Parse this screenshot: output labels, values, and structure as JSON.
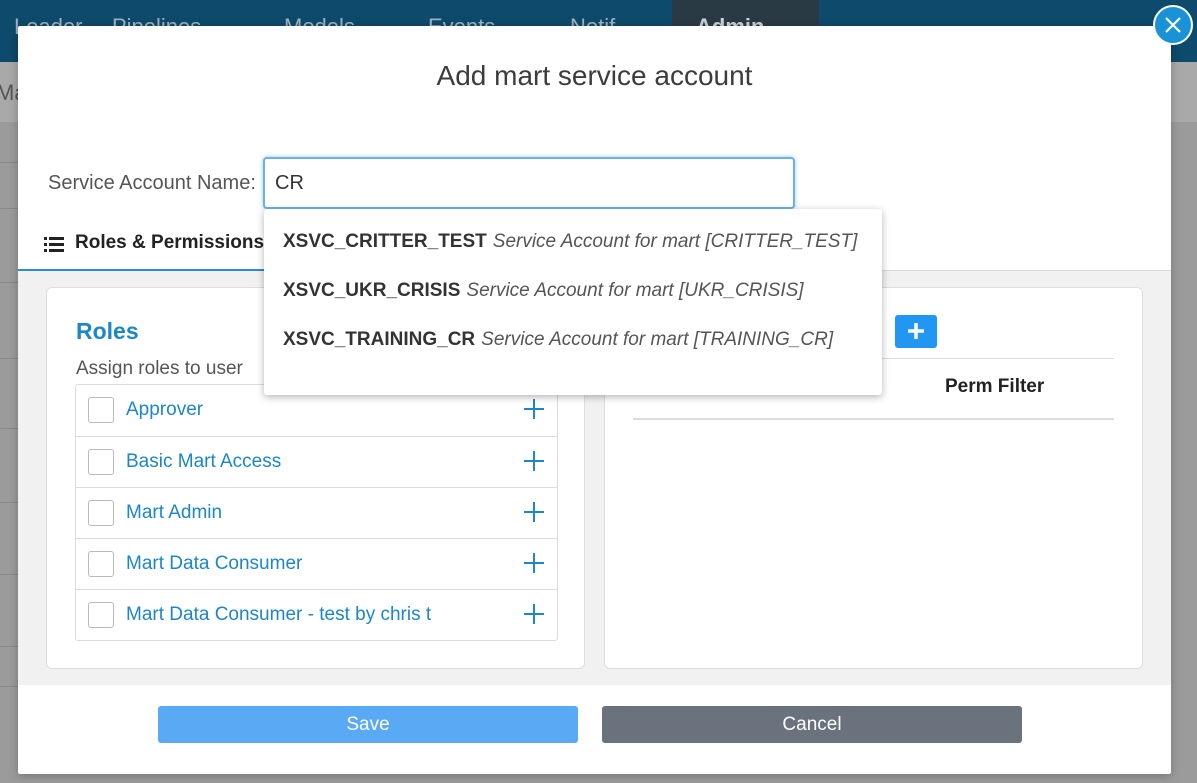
{
  "background": {
    "nav_items": [
      "Loader",
      "Pipelines",
      "Models",
      "Events",
      "Notif"
    ],
    "nav_active": "Admin",
    "subbar_text": "Ma"
  },
  "modal": {
    "title": "Add mart service account",
    "field_label": "Service Account Name:",
    "field_value": "CR",
    "tab_label": "Roles & Permissions",
    "roles_title": "Roles",
    "roles_subtitle": "Assign roles to user",
    "roles": [
      {
        "label": "Approver",
        "checked": false
      },
      {
        "label": "Basic Mart Access",
        "checked": false
      },
      {
        "label": "Mart Admin",
        "checked": false
      },
      {
        "label": "Mart Data Consumer",
        "checked": false
      },
      {
        "label": "Mart Data Consumer - test by chris t",
        "checked": false
      }
    ],
    "perm_filter_header": "Perm Filter",
    "save_label": "Save",
    "cancel_label": "Cancel"
  },
  "suggestions": [
    {
      "code": "XSVC_CRITTER_TEST",
      "description": "Service Account for mart [CRITTER_TEST]"
    },
    {
      "code": "XSVC_UKR_CRISIS",
      "description": "Service Account for mart [UKR_CRISIS]"
    },
    {
      "code": "XSVC_TRAINING_CR",
      "description": "Service Account for mart [TRAINING_CR]"
    }
  ],
  "icons": {
    "close": "close-icon",
    "tab": "list-icon",
    "role_add": "plus-icon",
    "perm_add": "plus-icon"
  },
  "colors": {
    "accent": "#1c86c8",
    "primary_button": "#5aa9f5",
    "secondary_button": "#6a737d",
    "close_button": "#1a93d6"
  }
}
